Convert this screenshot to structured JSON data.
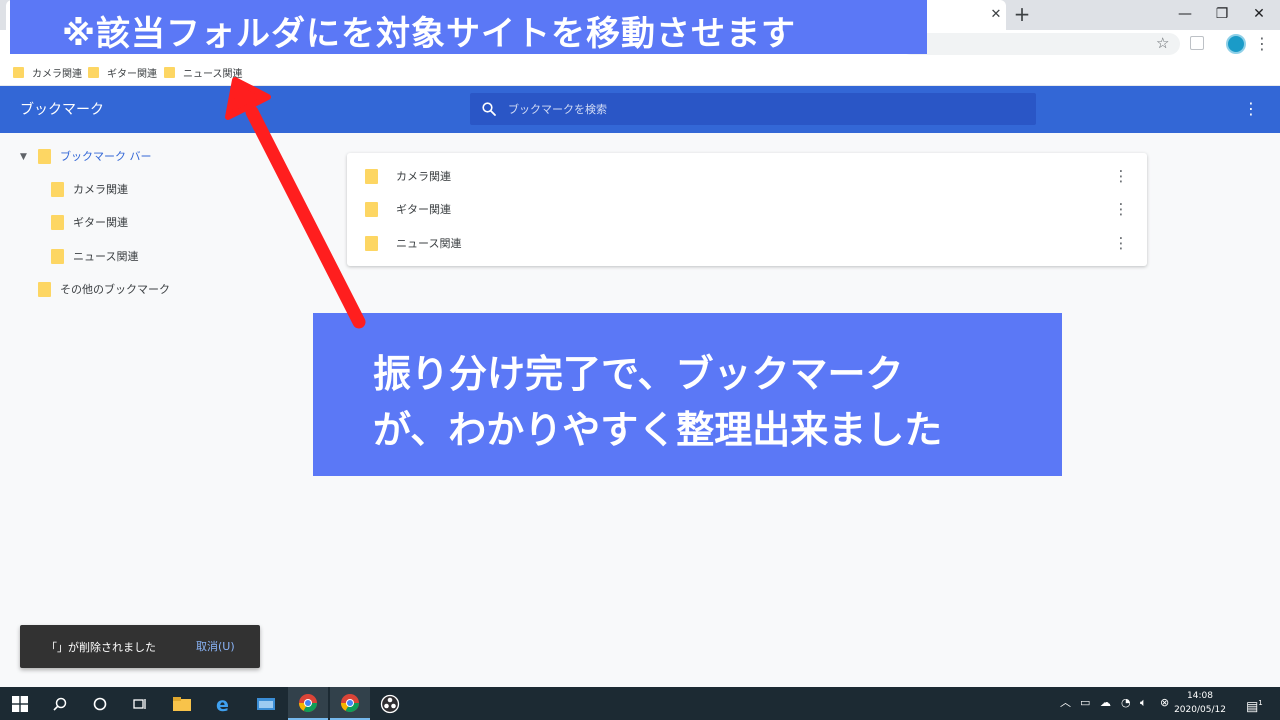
{
  "banner": {
    "text": "※該当フォルダにを対象サイトを移動させます"
  },
  "browser": {
    "tab_close_glyph": "✕",
    "new_tab_glyph": "+",
    "window_controls": {
      "minimize": "—",
      "restore": "❐",
      "close": "✕"
    },
    "star_glyph": "☆",
    "menu_glyph": "⋮"
  },
  "bookmarks_bar": {
    "items": [
      {
        "label": "カメラ関連"
      },
      {
        "label": "ギター関連"
      },
      {
        "label": "ニュース関連"
      }
    ]
  },
  "bookmark_manager": {
    "title": "ブックマーク",
    "search": {
      "placeholder": "ブックマークを検索",
      "value": ""
    },
    "menu_glyph": "⋮",
    "sidebar": {
      "root": {
        "label": "ブックマーク バー",
        "arrow": "▼"
      },
      "children": [
        {
          "label": "カメラ関連"
        },
        {
          "label": "ギター関連"
        },
        {
          "label": "ニュース関連"
        }
      ],
      "other": {
        "label": "その他のブックマーク"
      }
    },
    "list": {
      "rows": [
        {
          "label": "カメラ関連",
          "menu": "⋮"
        },
        {
          "label": "ギター関連",
          "menu": "⋮"
        },
        {
          "label": "ニュース関連",
          "menu": "⋮"
        }
      ]
    }
  },
  "note": {
    "line1": "振り分け完了で、ブックマーク",
    "line2": "が、わかりやすく整理出来ました"
  },
  "snackbar": {
    "message": "「」が削除されました",
    "undo_label": "取消(U)"
  },
  "taskbar": {
    "clock_time": "14:08",
    "clock_date": "2020/05/12",
    "notification_count": "1"
  },
  "colors": {
    "header_blue": "#3367d6",
    "annotation_blue": "#5b78f6",
    "arrow_red": "#ff1e1e",
    "folder_yellow": "#fdd663"
  }
}
